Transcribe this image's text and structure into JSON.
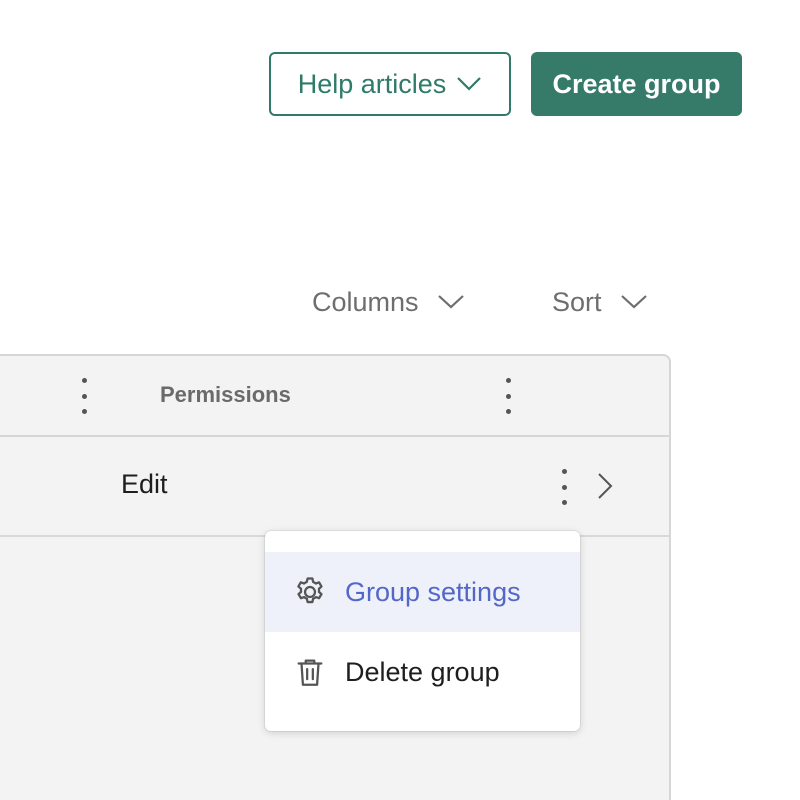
{
  "header": {
    "help_label": "Help articles",
    "create_label": "Create group"
  },
  "toolbar": {
    "columns_label": "Columns",
    "sort_label": "Sort"
  },
  "table": {
    "columns": [
      "",
      "Permissions"
    ],
    "rows": [
      {
        "permissions": "Edit"
      }
    ]
  },
  "menu": {
    "items": [
      {
        "label": "Group settings",
        "icon": "gear-icon",
        "highlighted": true
      },
      {
        "label": "Delete group",
        "icon": "trash-icon",
        "highlighted": false
      }
    ]
  },
  "colors": {
    "brand_green": "#367a69",
    "menu_highlight_bg": "#eef0fa",
    "menu_highlight_text": "#5367c8"
  }
}
